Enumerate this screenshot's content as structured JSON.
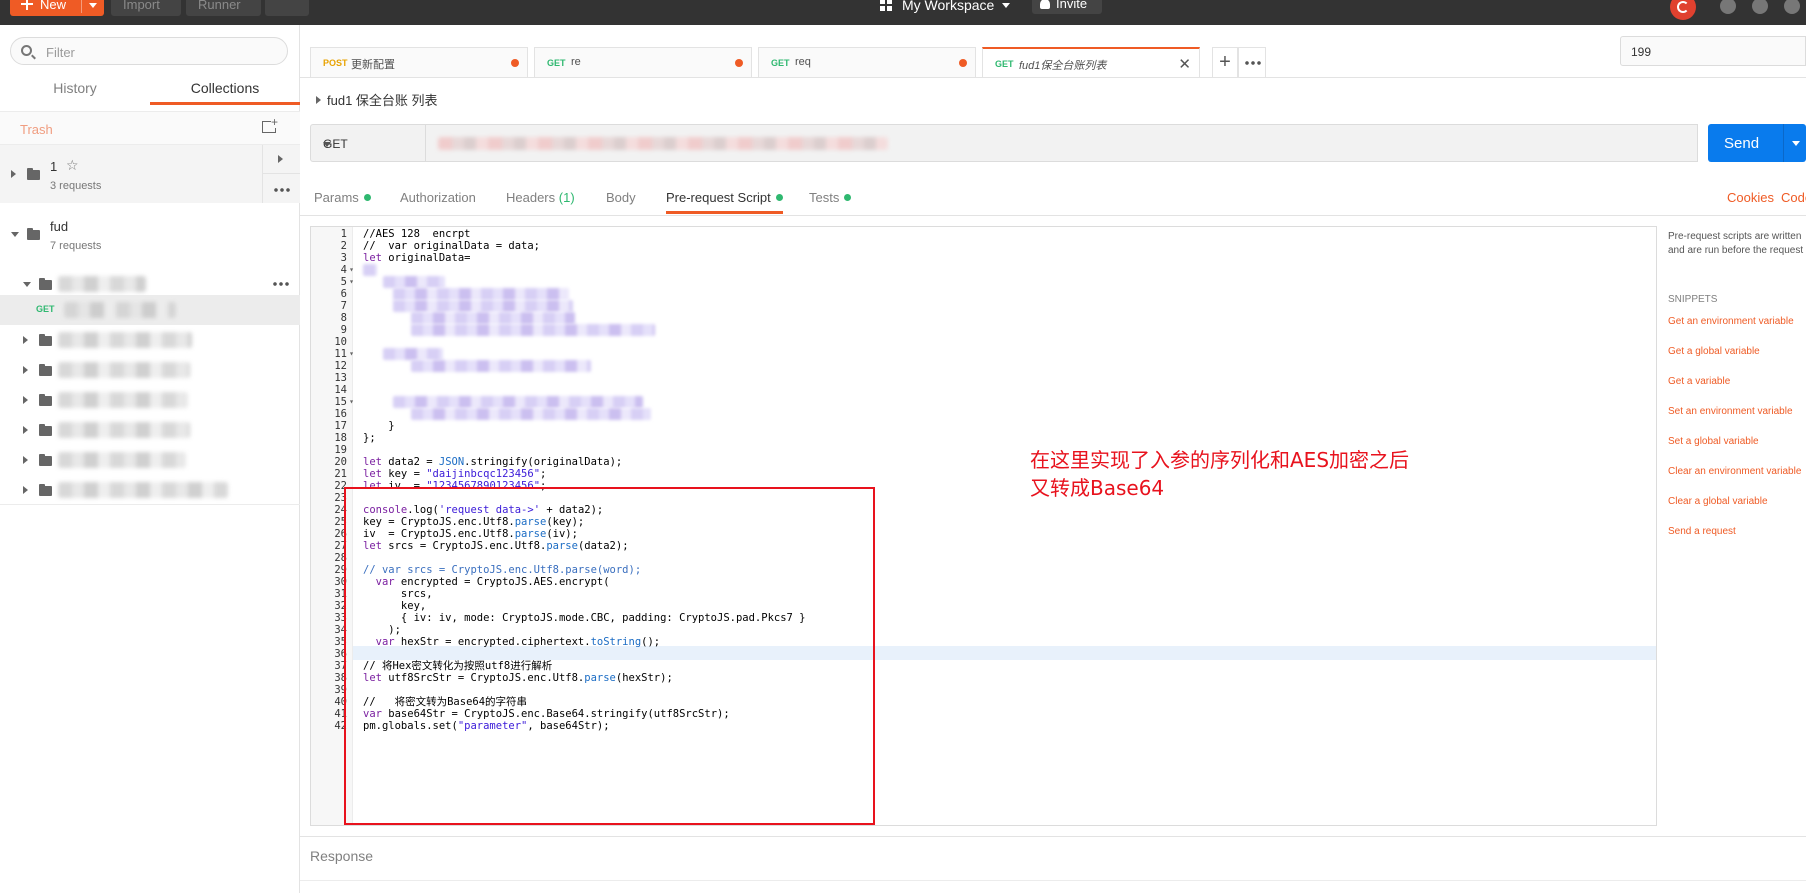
{
  "topbar": {
    "new_label": "New",
    "import_label": "Import",
    "runner_label": "Runner",
    "workspace_label": "My Workspace",
    "invite_label": "Invite"
  },
  "sidebar": {
    "filter_placeholder": "Filter",
    "tabs": [
      "History",
      "Collections"
    ],
    "active_tab": "Collections",
    "trash_label": "Trash",
    "collections": [
      {
        "name": "1",
        "count": "3 requests"
      },
      {
        "name": "fud",
        "count": "7 requests"
      }
    ],
    "selected_request_method": "GET"
  },
  "tabs": [
    {
      "method": "POST",
      "title": "更新配置",
      "method_color": "#e8a200"
    },
    {
      "method": "GET",
      "title": "re",
      "method_color": "#2fb870"
    },
    {
      "method": "GET",
      "title": "req",
      "method_color": "#2fb870"
    },
    {
      "method": "GET",
      "title": "fud1保全台账列表",
      "method_color": "#2fb870"
    }
  ],
  "environment_value": "199",
  "request": {
    "title": "fud1 保全台账 列表",
    "method": "GET",
    "send_label": "Send"
  },
  "request_tabs": {
    "params": "Params",
    "authorization": "Authorization",
    "headers": "Headers",
    "headers_count": "(1)",
    "body": "Body",
    "prerequest": "Pre-request Script",
    "tests": "Tests",
    "cookies": "Cookies",
    "code": "Code"
  },
  "code_lines": {
    "l1": "//AES 128  encrpt",
    "l2": "//  var originalData = data;",
    "l3_kw": "let",
    "l3": " originalData=",
    "l17": "    }",
    "l18": "};",
    "l20a": "let",
    "l20b": " data2 = ",
    "l20c": "JSON",
    "l20d": ".stringify(originalData);",
    "l21a": "let",
    "l21b": " key = ",
    "l21c": "\"daijinbcqc123456\"",
    "l21d": ";",
    "l22a": "let",
    "l22b": " iv  = ",
    "l22c": "\"1234567890123456\"",
    "l22d": ";",
    "l24a": "console",
    "l24b": ".log(",
    "l24c": "'request data->'",
    "l24d": " + data2);",
    "l25a": "key = CryptoJS.enc.Utf8.",
    "l25b": "parse",
    "l25c": "(key);",
    "l26a": "iv  = CryptoJS.enc.Utf8.",
    "l26b": "parse",
    "l26c": "(iv);",
    "l27a": "let",
    "l27b": " srcs = CryptoJS.enc.Utf8.",
    "l27c": "parse",
    "l27d": "(data2);",
    "l29": "// var srcs = CryptoJS.enc.Utf8.parse(word);",
    "l30a": "  var",
    "l30b": " encrypted = CryptoJS.AES.encrypt(",
    "l31": "      srcs,",
    "l32": "      key,",
    "l33": "      { iv: iv, mode: CryptoJS.mode.CBC, padding: CryptoJS.pad.Pkcs7 }",
    "l34": "    );",
    "l35a": "  var",
    "l35b": " hexStr = encrypted.ciphertext.",
    "l35c": "toString",
    "l35d": "();",
    "l37": "// 将Hex密文转化为按照utf8进行解析",
    "l38a": "let",
    "l38b": " utf8SrcStr = CryptoJS.enc.Utf8.",
    "l38c": "parse",
    "l38d": "(hexStr);",
    "l40": "//   将密文转为Base64的字符串",
    "l41a": "var",
    "l41b": " base64Str = CryptoJS.enc.Base64.stringify(utf8SrcStr);",
    "l42a": "pm.globals.set(",
    "l42b": "\"parameter\"",
    "l42c": ", base64Str);"
  },
  "annotation": {
    "line1": "在这里实现了入参的序列化和AES加密之后",
    "line2": "又转成Base64"
  },
  "right_panel": {
    "desc_line1": "Pre-request scripts are written",
    "desc_line2": "and are run before the request",
    "snippets_heading": "SNIPPETS",
    "snippets": [
      "Get an environment variable",
      "Get a global variable",
      "Get a variable",
      "Set an environment variable",
      "Set a global variable",
      "Clear an environment variable",
      "Clear a global variable",
      "Send a request"
    ]
  },
  "response_label": "Response",
  "colors": {
    "accent": "#ef5b25",
    "send": "#097bed",
    "get": "#2fb870",
    "post": "#e8a200",
    "annotation": "#e8121d"
  }
}
